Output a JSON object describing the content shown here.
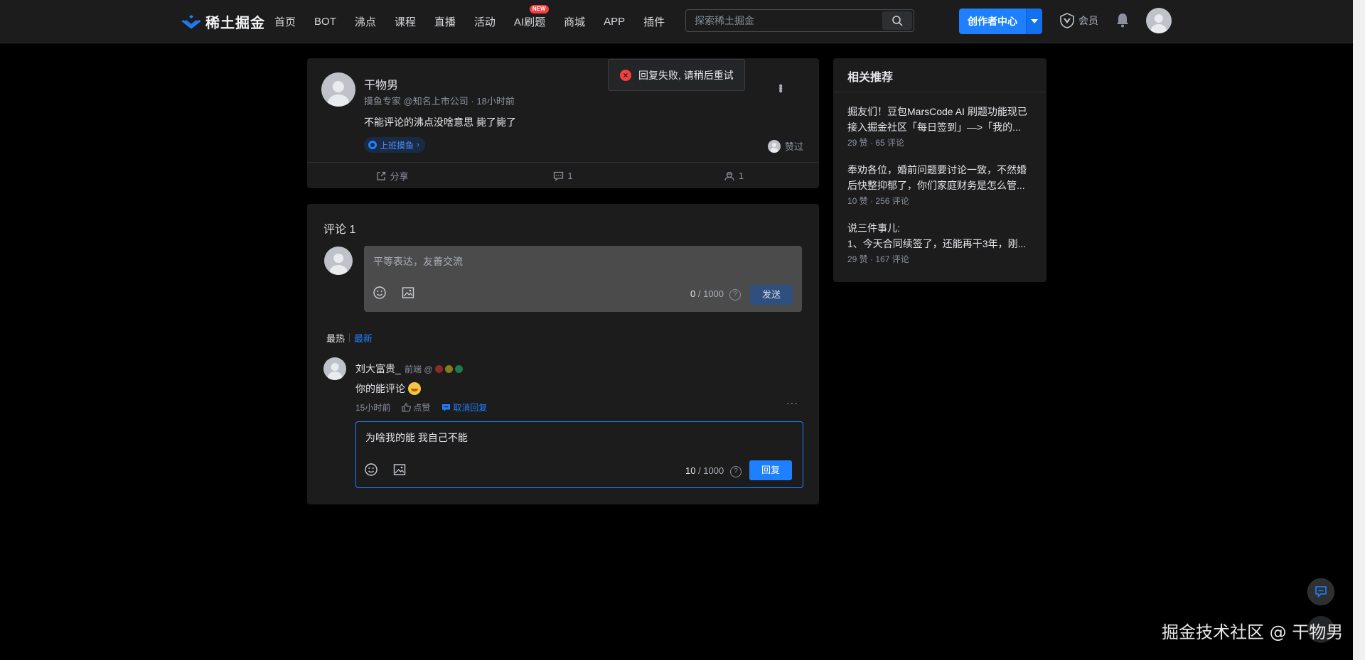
{
  "header": {
    "logo_text": "稀土掘金",
    "nav": [
      {
        "label": "首页"
      },
      {
        "label": "BOT"
      },
      {
        "label": "沸点"
      },
      {
        "label": "课程"
      },
      {
        "label": "直播"
      },
      {
        "label": "活动"
      },
      {
        "label": "AI刷题",
        "badge": "NEW"
      },
      {
        "label": "商城"
      },
      {
        "label": "APP"
      },
      {
        "label": "插件"
      }
    ],
    "search_placeholder": "探索稀土掘金",
    "creator_button": "创作者中心",
    "vip_label": "会员"
  },
  "post": {
    "author_name": "干物男",
    "author_meta": "摸鱼专家 @知名上市公司 · 18小时前",
    "content": "不能评论的沸点没啥意思 毙了毙了",
    "topic": "上班摸鱼",
    "liked_label": "赞过",
    "actions": {
      "share": "分享",
      "comments": "1",
      "likes": "1"
    }
  },
  "toast": {
    "message": "回复失败, 请稍后重试"
  },
  "comments": {
    "title": "评论 1",
    "editor": {
      "placeholder": "平等表达，友善交流",
      "count": "0",
      "max": " / 1000",
      "send": "发送"
    },
    "sort": {
      "hot": "最热",
      "new": "最新"
    },
    "items": [
      {
        "name": "刘大富贵_",
        "job": "前端 @",
        "text": "你的能评论",
        "time": "15小时前",
        "like": "点赞",
        "cancel_reply": "取消回复",
        "reply": {
          "value": "为啥我的能 我自己不能",
          "count": "10",
          "max": " / 1000",
          "button": "回复"
        }
      }
    ]
  },
  "recommendations": {
    "title": "相关推荐",
    "items": [
      {
        "line1": "掘友们！豆包MarsCode AI 刷题功能现已",
        "line2": "接入掘金社区「每日签到」—>「我的...",
        "meta": "29 赞 · 65 评论"
      },
      {
        "line1": "奉劝各位，婚前问题要讨论一致，不然婚",
        "line2": "后快整抑郁了，你们家庭财务是怎么管...",
        "meta": "10 赞 · 256 评论"
      },
      {
        "line1": "说三件事儿:",
        "line2": "1、今天合同续签了，还能再干3年，刚...",
        "meta": "29 赞 · 167 评论"
      }
    ]
  },
  "watermark": "掘金技术社区 @ 干物男",
  "colors": {
    "accent": "#1e80ff",
    "error": "#f53f3f",
    "background": "#000000",
    "card": "#1c1c1c"
  }
}
